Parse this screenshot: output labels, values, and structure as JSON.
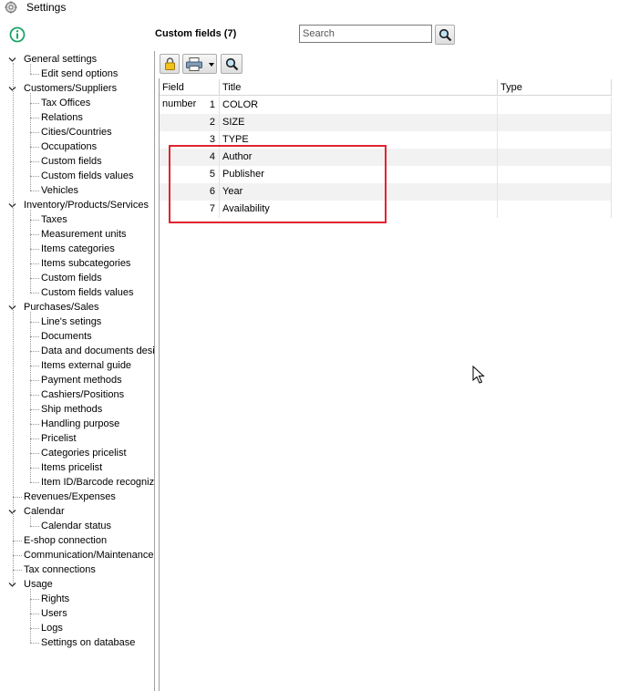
{
  "window": {
    "title": "Settings"
  },
  "header": {
    "title": "Custom fields (7)",
    "search_placeholder": "Search"
  },
  "sidebar": {
    "groups": [
      {
        "label": "General settings",
        "children": [
          "Edit send options"
        ]
      },
      {
        "label": "Customers/Suppliers",
        "children": [
          "Tax Offices",
          "Relations",
          "Cities/Countries",
          "Occupations",
          "Custom fields",
          "Custom fields values",
          "Vehicles"
        ]
      },
      {
        "label": "Inventory/Products/Services",
        "children": [
          "Taxes",
          "Measurement units",
          "Items categories",
          "Items subcategories",
          "Custom fields",
          "Custom fields values"
        ]
      },
      {
        "label": "Purchases/Sales",
        "children": [
          "Line's setings",
          "Documents",
          "Data and documents desi",
          "Items external guide",
          "Payment methods",
          "Cashiers/Positions",
          "Ship methods",
          "Handling purpose",
          "Pricelist",
          "Categories pricelist",
          "Items pricelist",
          "Item ID/Barcode recognize"
        ]
      },
      {
        "label": "Revenues/Expenses",
        "children": []
      },
      {
        "label": "Calendar",
        "children": [
          "Calendar status"
        ]
      },
      {
        "label": "E-shop connection",
        "children": []
      },
      {
        "label": "Communication/Maintenance",
        "children": []
      },
      {
        "label": "Tax connections",
        "children": []
      },
      {
        "label": "Usage",
        "children": [
          "Rights",
          "Users",
          "Logs",
          "Settings on database"
        ]
      }
    ]
  },
  "grid": {
    "columns": [
      "Field number",
      "Title",
      "Type"
    ],
    "rows": [
      {
        "number": "1",
        "title": "COLOR",
        "type": ""
      },
      {
        "number": "2",
        "title": "SIZE",
        "type": ""
      },
      {
        "number": "3",
        "title": "TYPE",
        "type": ""
      },
      {
        "number": "4",
        "title": "Author",
        "type": ""
      },
      {
        "number": "5",
        "title": "Publisher",
        "type": ""
      },
      {
        "number": "6",
        "title": "Year",
        "type": ""
      },
      {
        "number": "7",
        "title": "Availability",
        "type": ""
      }
    ]
  },
  "colors": {
    "highlight": "#e0242f",
    "info_icon": "#1ea56b"
  },
  "icons": [
    "settings-app-icon",
    "info-icon",
    "search-icon",
    "lock-icon",
    "printer-icon",
    "chevron-down-icon",
    "zoom-icon",
    "cursor-icon"
  ]
}
